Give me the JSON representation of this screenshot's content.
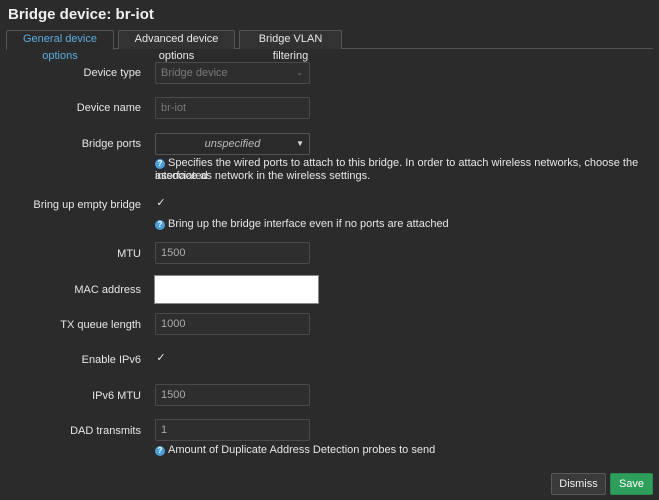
{
  "title": "Bridge device: br-iot",
  "tabs": [
    {
      "label": "General device options",
      "active": true
    },
    {
      "label": "Advanced device options",
      "active": false
    },
    {
      "label": "Bridge VLAN filtering",
      "active": false
    }
  ],
  "fields": {
    "device_type": {
      "label": "Device type",
      "value": "Bridge device"
    },
    "device_name": {
      "label": "Device name",
      "value": "br-iot"
    },
    "bridge_ports": {
      "label": "Bridge ports",
      "value": "unspecified",
      "help_line1": "Specifies the wired ports to attach to this bridge. In order to attach wireless networks, choose the associated",
      "help_line2": "interface as network in the wireless settings."
    },
    "bring_up_empty": {
      "label": "Bring up empty bridge",
      "checked": true,
      "help": "Bring up the bridge interface even if no ports are attached"
    },
    "mtu": {
      "label": "MTU",
      "value": "1500"
    },
    "mac_address": {
      "label": "MAC address",
      "value": ""
    },
    "tx_queue_length": {
      "label": "TX queue length",
      "value": "1000"
    },
    "enable_ipv6": {
      "label": "Enable IPv6",
      "checked": true
    },
    "ipv6_mtu": {
      "label": "IPv6 MTU",
      "value": "1500"
    },
    "dad_transmits": {
      "label": "DAD transmits",
      "value": "1",
      "help": "Amount of Duplicate Address Detection probes to send"
    }
  },
  "icons": {
    "help": "question-circle-icon",
    "check": "checkmark-icon",
    "caret": "caret-down-icon"
  },
  "colors": {
    "accent": "#5dade2",
    "save": "#2e9e5b",
    "background": "#2b2b2b"
  },
  "buttons": {
    "dismiss": "Dismiss",
    "save": "Save"
  }
}
